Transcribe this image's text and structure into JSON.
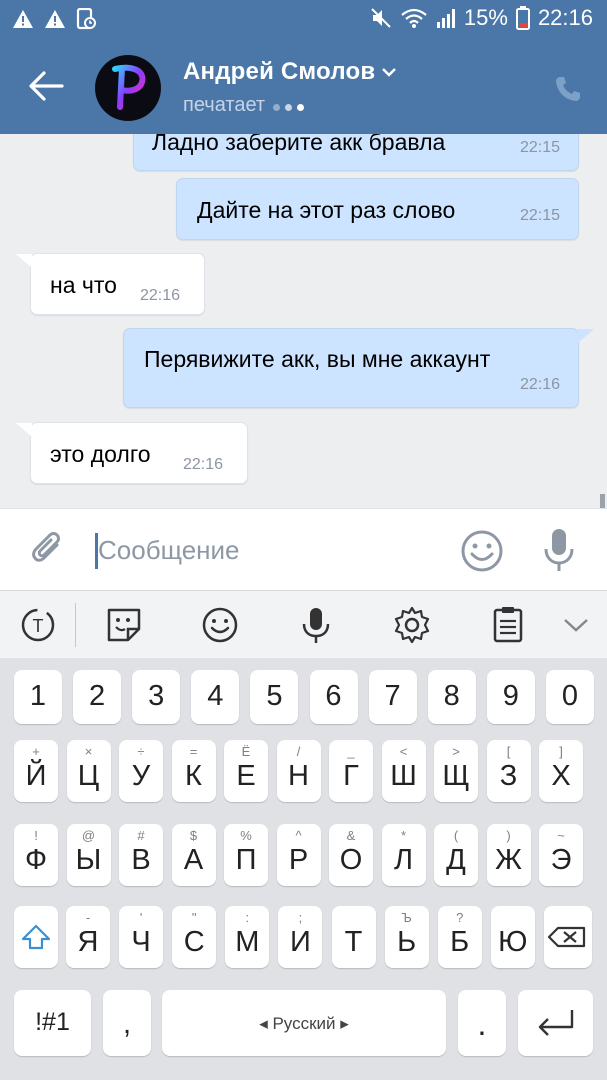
{
  "status_bar": {
    "battery": "15%",
    "time": "22:16"
  },
  "header": {
    "contact_name": "Андрей Смолов",
    "status": "печатает"
  },
  "messages": [
    {
      "dir": "out",
      "text": "Ладно заберите акк бравла",
      "time": "22:15"
    },
    {
      "dir": "out",
      "text": "Дайте на этот раз слово",
      "time": "22:15"
    },
    {
      "dir": "in",
      "text": "на что",
      "time": "22:16"
    },
    {
      "dir": "out",
      "text": "Перявижите акк, вы мне аккаунт",
      "time": "22:16"
    },
    {
      "dir": "in",
      "text": "это долго",
      "time": "22:16"
    }
  ],
  "composer": {
    "placeholder": "Сообщение"
  },
  "keyboard": {
    "numbers": [
      "1",
      "2",
      "3",
      "4",
      "5",
      "6",
      "7",
      "8",
      "9",
      "0"
    ],
    "row1": {
      "keys": [
        "Й",
        "Ц",
        "У",
        "К",
        "Е",
        "Н",
        "Г",
        "Ш",
        "Щ",
        "З",
        "Х"
      ],
      "hints": [
        "+",
        "×",
        "÷",
        "=",
        "Ё",
        "/",
        "_",
        "<",
        ">",
        "[",
        "]"
      ]
    },
    "row2": {
      "keys": [
        "Ф",
        "Ы",
        "В",
        "А",
        "П",
        "Р",
        "О",
        "Л",
        "Д",
        "Ж",
        "Э"
      ],
      "hints": [
        "!",
        "@",
        "#",
        "$",
        "%",
        "^",
        "&",
        "*",
        "(",
        ")",
        "~"
      ]
    },
    "row3": {
      "keys": [
        "Я",
        "Ч",
        "С",
        "М",
        "И",
        "Т",
        "Ь",
        "Б",
        "Ю"
      ],
      "hints": [
        "-",
        "'",
        "\"",
        ":",
        ";",
        "",
        "Ъ",
        "?",
        ""
      ]
    },
    "symbols_label": "!#1",
    "comma": ",",
    "space_label": "Русский",
    "period": "."
  }
}
